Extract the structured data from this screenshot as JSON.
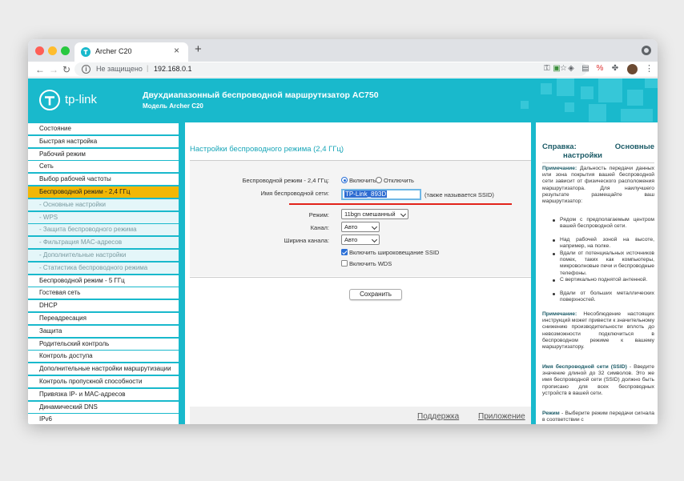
{
  "browser": {
    "tab_title": "Archer C20",
    "new_tab": "+",
    "not_secure": "Не защищено",
    "url": "192.168.0.1"
  },
  "header": {
    "brand": "tp-link",
    "title": "Двухдиапазонный беспроводной маршрутизатор AC750",
    "model": "Модель Archer C20"
  },
  "sidebar": {
    "items": [
      {
        "label": "Состояние",
        "type": "main"
      },
      {
        "label": "Быстрая настройка",
        "type": "main"
      },
      {
        "label": "Рабочий режим",
        "type": "main"
      },
      {
        "label": "Сеть",
        "type": "main"
      },
      {
        "label": "Выбор рабочей частоты",
        "type": "main"
      },
      {
        "label": "Беспроводной режим - 2,4 ГГц",
        "type": "active"
      },
      {
        "label": "- Основные настройки",
        "type": "sub"
      },
      {
        "label": "- WPS",
        "type": "sub"
      },
      {
        "label": "- Защита беспроводного режима",
        "type": "sub"
      },
      {
        "label": "- Фильтрация MAC-адресов",
        "type": "sub"
      },
      {
        "label": "- Дополнительные настройки",
        "type": "sub"
      },
      {
        "label": "- Статистика беспроводного режима",
        "type": "sub"
      },
      {
        "label": "Беспроводной режим - 5 ГГц",
        "type": "main"
      },
      {
        "label": "Гостевая сеть",
        "type": "main"
      },
      {
        "label": "DHCP",
        "type": "main"
      },
      {
        "label": "Переадресация",
        "type": "main"
      },
      {
        "label": "Защита",
        "type": "main"
      },
      {
        "label": "Родительский контроль",
        "type": "main"
      },
      {
        "label": "Контроль доступа",
        "type": "main"
      },
      {
        "label": "Дополнительные настройки маршрутизации",
        "type": "main"
      },
      {
        "label": "Контроль пропускной способности",
        "type": "main"
      },
      {
        "label": "Привязка IP- и MAC-адресов",
        "type": "main"
      },
      {
        "label": "Динамический DNS",
        "type": "main"
      },
      {
        "label": "IPv6",
        "type": "main"
      },
      {
        "label": "Системные инструменты",
        "type": "main"
      }
    ]
  },
  "form": {
    "section_title": "Настройки беспроводного режима (2,4 ГГц)",
    "radio_label": "Беспроводной режим - 2,4 ГГц:",
    "radio_on": "Включить",
    "radio_off": "Отключить",
    "ssid_label": "Имя беспроводной сети:",
    "ssid_value": "TP-Link_893D",
    "ssid_note": "(также называется SSID)",
    "mode_label": "Режим:",
    "mode_value": "11bgn смешанный",
    "channel_label": "Канал:",
    "channel_value": "Авто",
    "width_label": "Ширина канала:",
    "width_value": "Авто",
    "broadcast_label": "Включить широковещание SSID",
    "wds_label": "Включить WDS",
    "save": "Сохранить",
    "support": "Поддержка",
    "app": "Приложение"
  },
  "help": {
    "title_left": "Справка:",
    "title_right": "Основные",
    "title_line2": "настройки",
    "note1_bold": "Примечание:",
    "note1": "Дальность передачи данных или зона покрытия вашей беспроводной сети зависит от физического расположения маршрутизатора. Для наилучшего результате размещайте ваш маршрутизатор:",
    "bullets": [
      "Рядом с предполагаемым центром вашей беспроводной сети.",
      "Над рабочей зоной на высоте, например, на полке.",
      "Вдали от потенциальных источников помех, таких как компьютеры, микроволновые печи и беспроводные телефоны.",
      "С вертикально поднятой антенной.",
      "Вдали от больших металлических поверхностей."
    ],
    "note2_bold": "Примечание:",
    "note2": "Несоблюдение настоящих инструкций может привести к значительному снижению производительности вплоть до невозможности подключиться в беспроводном режиме к вашему маршрутизатору.",
    "ssid_bold": "Имя беспроводной сети (SSID)",
    "ssid_text": "- Введите значение длиной до 32 символов. Это же имя беспроводной сети (SSID) должно быть прописано для всех беспроводных устройств в вашей сети.",
    "mode_bold": "Режим",
    "mode_text": "- Выберите режим передачи сигнала в соответствии с"
  },
  "colors": {
    "accent": "#19b9cc",
    "active_menu": "#f2b705",
    "highlight_line": "#e2231a"
  }
}
